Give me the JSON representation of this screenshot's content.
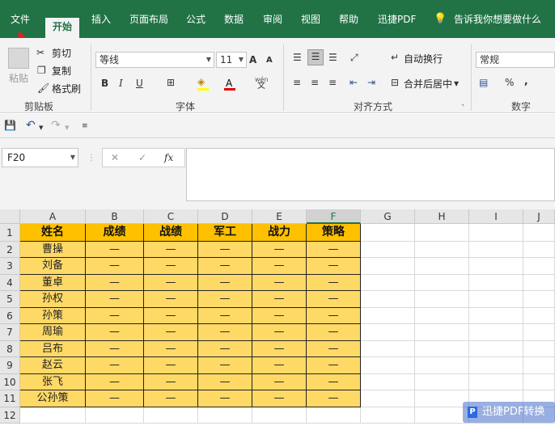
{
  "ribbon_tabs": [
    "文件",
    "开始",
    "插入",
    "页面布局",
    "公式",
    "数据",
    "审阅",
    "视图",
    "帮助",
    "迅捷PDF",
    "告诉我你想要做什么"
  ],
  "clipboard": {
    "paste": "粘贴",
    "cut": "剪切",
    "copy": "复制",
    "format_painter": "格式刷",
    "label": "剪贴板"
  },
  "font": {
    "name": "等线",
    "size": "11",
    "grow": "A",
    "shrink": "A",
    "bold": "B",
    "italic": "I",
    "underline": "U",
    "label": "字体",
    "wen": "wén"
  },
  "align": {
    "wrap": "自动换行",
    "merge": "合并后居中",
    "label": "对齐方式"
  },
  "number": {
    "format": "常规",
    "percent": "%",
    "comma": ",",
    "label": "数字"
  },
  "formula_bar": {
    "name_box": "F20",
    "fx": "fx",
    "value": ""
  },
  "columns": [
    "A",
    "B",
    "C",
    "D",
    "E",
    "F",
    "G",
    "H",
    "I",
    "J"
  ],
  "rows": [
    "1",
    "2",
    "3",
    "4",
    "5",
    "6",
    "7",
    "8",
    "9",
    "10",
    "11",
    "12"
  ],
  "table": {
    "headers": [
      "姓名",
      "成绩",
      "战绩",
      "军工",
      "战力",
      "策略"
    ],
    "names": [
      "曹操",
      "刘备",
      "董卓",
      "孙权",
      "孙策",
      "周瑜",
      "吕布",
      "赵云",
      "张飞",
      "公孙策"
    ],
    "dash": "—"
  },
  "watermark": "迅捷PDF转换器",
  "colors": {
    "excel_green": "#217346",
    "header_fill": "#ffc000",
    "body_fill": "#ffd966",
    "arrow": "#e02020"
  }
}
